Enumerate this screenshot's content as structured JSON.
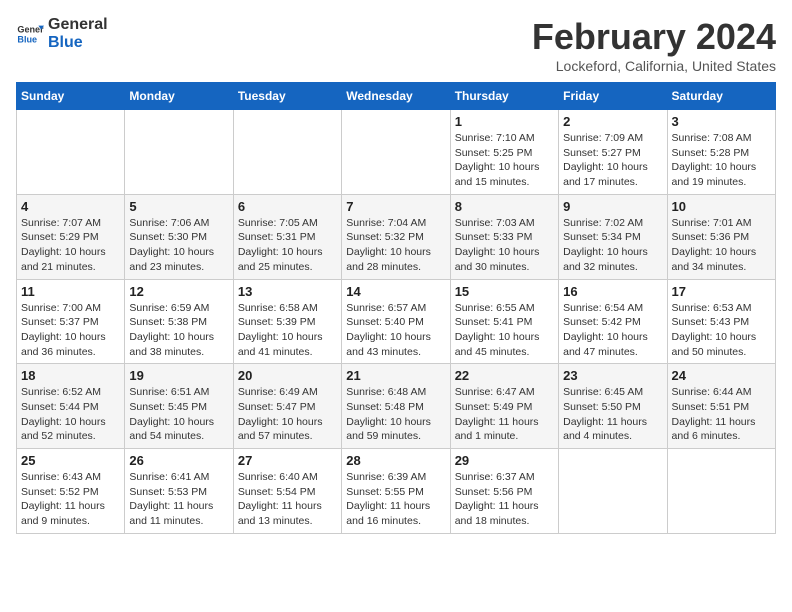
{
  "logo": {
    "line1": "General",
    "line2": "Blue"
  },
  "title": "February 2024",
  "subtitle": "Lockeford, California, United States",
  "days_of_week": [
    "Sunday",
    "Monday",
    "Tuesday",
    "Wednesday",
    "Thursday",
    "Friday",
    "Saturday"
  ],
  "weeks": [
    [
      {
        "day": "",
        "info": ""
      },
      {
        "day": "",
        "info": ""
      },
      {
        "day": "",
        "info": ""
      },
      {
        "day": "",
        "info": ""
      },
      {
        "day": "1",
        "info": "Sunrise: 7:10 AM\nSunset: 5:25 PM\nDaylight: 10 hours\nand 15 minutes."
      },
      {
        "day": "2",
        "info": "Sunrise: 7:09 AM\nSunset: 5:27 PM\nDaylight: 10 hours\nand 17 minutes."
      },
      {
        "day": "3",
        "info": "Sunrise: 7:08 AM\nSunset: 5:28 PM\nDaylight: 10 hours\nand 19 minutes."
      }
    ],
    [
      {
        "day": "4",
        "info": "Sunrise: 7:07 AM\nSunset: 5:29 PM\nDaylight: 10 hours\nand 21 minutes."
      },
      {
        "day": "5",
        "info": "Sunrise: 7:06 AM\nSunset: 5:30 PM\nDaylight: 10 hours\nand 23 minutes."
      },
      {
        "day": "6",
        "info": "Sunrise: 7:05 AM\nSunset: 5:31 PM\nDaylight: 10 hours\nand 25 minutes."
      },
      {
        "day": "7",
        "info": "Sunrise: 7:04 AM\nSunset: 5:32 PM\nDaylight: 10 hours\nand 28 minutes."
      },
      {
        "day": "8",
        "info": "Sunrise: 7:03 AM\nSunset: 5:33 PM\nDaylight: 10 hours\nand 30 minutes."
      },
      {
        "day": "9",
        "info": "Sunrise: 7:02 AM\nSunset: 5:34 PM\nDaylight: 10 hours\nand 32 minutes."
      },
      {
        "day": "10",
        "info": "Sunrise: 7:01 AM\nSunset: 5:36 PM\nDaylight: 10 hours\nand 34 minutes."
      }
    ],
    [
      {
        "day": "11",
        "info": "Sunrise: 7:00 AM\nSunset: 5:37 PM\nDaylight: 10 hours\nand 36 minutes."
      },
      {
        "day": "12",
        "info": "Sunrise: 6:59 AM\nSunset: 5:38 PM\nDaylight: 10 hours\nand 38 minutes."
      },
      {
        "day": "13",
        "info": "Sunrise: 6:58 AM\nSunset: 5:39 PM\nDaylight: 10 hours\nand 41 minutes."
      },
      {
        "day": "14",
        "info": "Sunrise: 6:57 AM\nSunset: 5:40 PM\nDaylight: 10 hours\nand 43 minutes."
      },
      {
        "day": "15",
        "info": "Sunrise: 6:55 AM\nSunset: 5:41 PM\nDaylight: 10 hours\nand 45 minutes."
      },
      {
        "day": "16",
        "info": "Sunrise: 6:54 AM\nSunset: 5:42 PM\nDaylight: 10 hours\nand 47 minutes."
      },
      {
        "day": "17",
        "info": "Sunrise: 6:53 AM\nSunset: 5:43 PM\nDaylight: 10 hours\nand 50 minutes."
      }
    ],
    [
      {
        "day": "18",
        "info": "Sunrise: 6:52 AM\nSunset: 5:44 PM\nDaylight: 10 hours\nand 52 minutes."
      },
      {
        "day": "19",
        "info": "Sunrise: 6:51 AM\nSunset: 5:45 PM\nDaylight: 10 hours\nand 54 minutes."
      },
      {
        "day": "20",
        "info": "Sunrise: 6:49 AM\nSunset: 5:47 PM\nDaylight: 10 hours\nand 57 minutes."
      },
      {
        "day": "21",
        "info": "Sunrise: 6:48 AM\nSunset: 5:48 PM\nDaylight: 10 hours\nand 59 minutes."
      },
      {
        "day": "22",
        "info": "Sunrise: 6:47 AM\nSunset: 5:49 PM\nDaylight: 11 hours\nand 1 minute."
      },
      {
        "day": "23",
        "info": "Sunrise: 6:45 AM\nSunset: 5:50 PM\nDaylight: 11 hours\nand 4 minutes."
      },
      {
        "day": "24",
        "info": "Sunrise: 6:44 AM\nSunset: 5:51 PM\nDaylight: 11 hours\nand 6 minutes."
      }
    ],
    [
      {
        "day": "25",
        "info": "Sunrise: 6:43 AM\nSunset: 5:52 PM\nDaylight: 11 hours\nand 9 minutes."
      },
      {
        "day": "26",
        "info": "Sunrise: 6:41 AM\nSunset: 5:53 PM\nDaylight: 11 hours\nand 11 minutes."
      },
      {
        "day": "27",
        "info": "Sunrise: 6:40 AM\nSunset: 5:54 PM\nDaylight: 11 hours\nand 13 minutes."
      },
      {
        "day": "28",
        "info": "Sunrise: 6:39 AM\nSunset: 5:55 PM\nDaylight: 11 hours\nand 16 minutes."
      },
      {
        "day": "29",
        "info": "Sunrise: 6:37 AM\nSunset: 5:56 PM\nDaylight: 11 hours\nand 18 minutes."
      },
      {
        "day": "",
        "info": ""
      },
      {
        "day": "",
        "info": ""
      }
    ]
  ]
}
